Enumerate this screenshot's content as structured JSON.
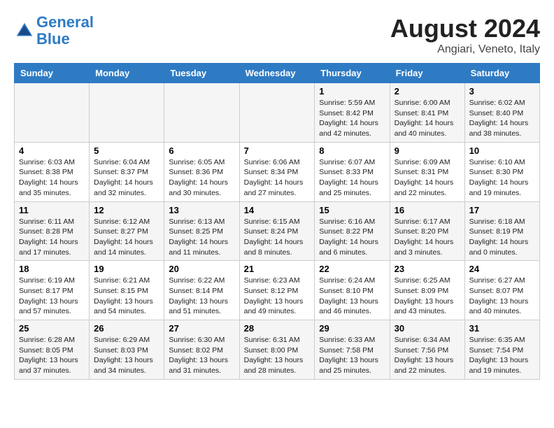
{
  "logo": {
    "line1": "General",
    "line2": "Blue"
  },
  "header": {
    "month_year": "August 2024",
    "location": "Angiari, Veneto, Italy"
  },
  "days_of_week": [
    "Sunday",
    "Monday",
    "Tuesday",
    "Wednesday",
    "Thursday",
    "Friday",
    "Saturday"
  ],
  "weeks": [
    [
      {
        "day": "",
        "info": ""
      },
      {
        "day": "",
        "info": ""
      },
      {
        "day": "",
        "info": ""
      },
      {
        "day": "",
        "info": ""
      },
      {
        "day": "1",
        "info": "Sunrise: 5:59 AM\nSunset: 8:42 PM\nDaylight: 14 hours\nand 42 minutes."
      },
      {
        "day": "2",
        "info": "Sunrise: 6:00 AM\nSunset: 8:41 PM\nDaylight: 14 hours\nand 40 minutes."
      },
      {
        "day": "3",
        "info": "Sunrise: 6:02 AM\nSunset: 8:40 PM\nDaylight: 14 hours\nand 38 minutes."
      }
    ],
    [
      {
        "day": "4",
        "info": "Sunrise: 6:03 AM\nSunset: 8:38 PM\nDaylight: 14 hours\nand 35 minutes."
      },
      {
        "day": "5",
        "info": "Sunrise: 6:04 AM\nSunset: 8:37 PM\nDaylight: 14 hours\nand 32 minutes."
      },
      {
        "day": "6",
        "info": "Sunrise: 6:05 AM\nSunset: 8:36 PM\nDaylight: 14 hours\nand 30 minutes."
      },
      {
        "day": "7",
        "info": "Sunrise: 6:06 AM\nSunset: 8:34 PM\nDaylight: 14 hours\nand 27 minutes."
      },
      {
        "day": "8",
        "info": "Sunrise: 6:07 AM\nSunset: 8:33 PM\nDaylight: 14 hours\nand 25 minutes."
      },
      {
        "day": "9",
        "info": "Sunrise: 6:09 AM\nSunset: 8:31 PM\nDaylight: 14 hours\nand 22 minutes."
      },
      {
        "day": "10",
        "info": "Sunrise: 6:10 AM\nSunset: 8:30 PM\nDaylight: 14 hours\nand 19 minutes."
      }
    ],
    [
      {
        "day": "11",
        "info": "Sunrise: 6:11 AM\nSunset: 8:28 PM\nDaylight: 14 hours\nand 17 minutes."
      },
      {
        "day": "12",
        "info": "Sunrise: 6:12 AM\nSunset: 8:27 PM\nDaylight: 14 hours\nand 14 minutes."
      },
      {
        "day": "13",
        "info": "Sunrise: 6:13 AM\nSunset: 8:25 PM\nDaylight: 14 hours\nand 11 minutes."
      },
      {
        "day": "14",
        "info": "Sunrise: 6:15 AM\nSunset: 8:24 PM\nDaylight: 14 hours\nand 8 minutes."
      },
      {
        "day": "15",
        "info": "Sunrise: 6:16 AM\nSunset: 8:22 PM\nDaylight: 14 hours\nand 6 minutes."
      },
      {
        "day": "16",
        "info": "Sunrise: 6:17 AM\nSunset: 8:20 PM\nDaylight: 14 hours\nand 3 minutes."
      },
      {
        "day": "17",
        "info": "Sunrise: 6:18 AM\nSunset: 8:19 PM\nDaylight: 14 hours\nand 0 minutes."
      }
    ],
    [
      {
        "day": "18",
        "info": "Sunrise: 6:19 AM\nSunset: 8:17 PM\nDaylight: 13 hours\nand 57 minutes."
      },
      {
        "day": "19",
        "info": "Sunrise: 6:21 AM\nSunset: 8:15 PM\nDaylight: 13 hours\nand 54 minutes."
      },
      {
        "day": "20",
        "info": "Sunrise: 6:22 AM\nSunset: 8:14 PM\nDaylight: 13 hours\nand 51 minutes."
      },
      {
        "day": "21",
        "info": "Sunrise: 6:23 AM\nSunset: 8:12 PM\nDaylight: 13 hours\nand 49 minutes."
      },
      {
        "day": "22",
        "info": "Sunrise: 6:24 AM\nSunset: 8:10 PM\nDaylight: 13 hours\nand 46 minutes."
      },
      {
        "day": "23",
        "info": "Sunrise: 6:25 AM\nSunset: 8:09 PM\nDaylight: 13 hours\nand 43 minutes."
      },
      {
        "day": "24",
        "info": "Sunrise: 6:27 AM\nSunset: 8:07 PM\nDaylight: 13 hours\nand 40 minutes."
      }
    ],
    [
      {
        "day": "25",
        "info": "Sunrise: 6:28 AM\nSunset: 8:05 PM\nDaylight: 13 hours\nand 37 minutes."
      },
      {
        "day": "26",
        "info": "Sunrise: 6:29 AM\nSunset: 8:03 PM\nDaylight: 13 hours\nand 34 minutes."
      },
      {
        "day": "27",
        "info": "Sunrise: 6:30 AM\nSunset: 8:02 PM\nDaylight: 13 hours\nand 31 minutes."
      },
      {
        "day": "28",
        "info": "Sunrise: 6:31 AM\nSunset: 8:00 PM\nDaylight: 13 hours\nand 28 minutes."
      },
      {
        "day": "29",
        "info": "Sunrise: 6:33 AM\nSunset: 7:58 PM\nDaylight: 13 hours\nand 25 minutes."
      },
      {
        "day": "30",
        "info": "Sunrise: 6:34 AM\nSunset: 7:56 PM\nDaylight: 13 hours\nand 22 minutes."
      },
      {
        "day": "31",
        "info": "Sunrise: 6:35 AM\nSunset: 7:54 PM\nDaylight: 13 hours\nand 19 minutes."
      }
    ]
  ]
}
